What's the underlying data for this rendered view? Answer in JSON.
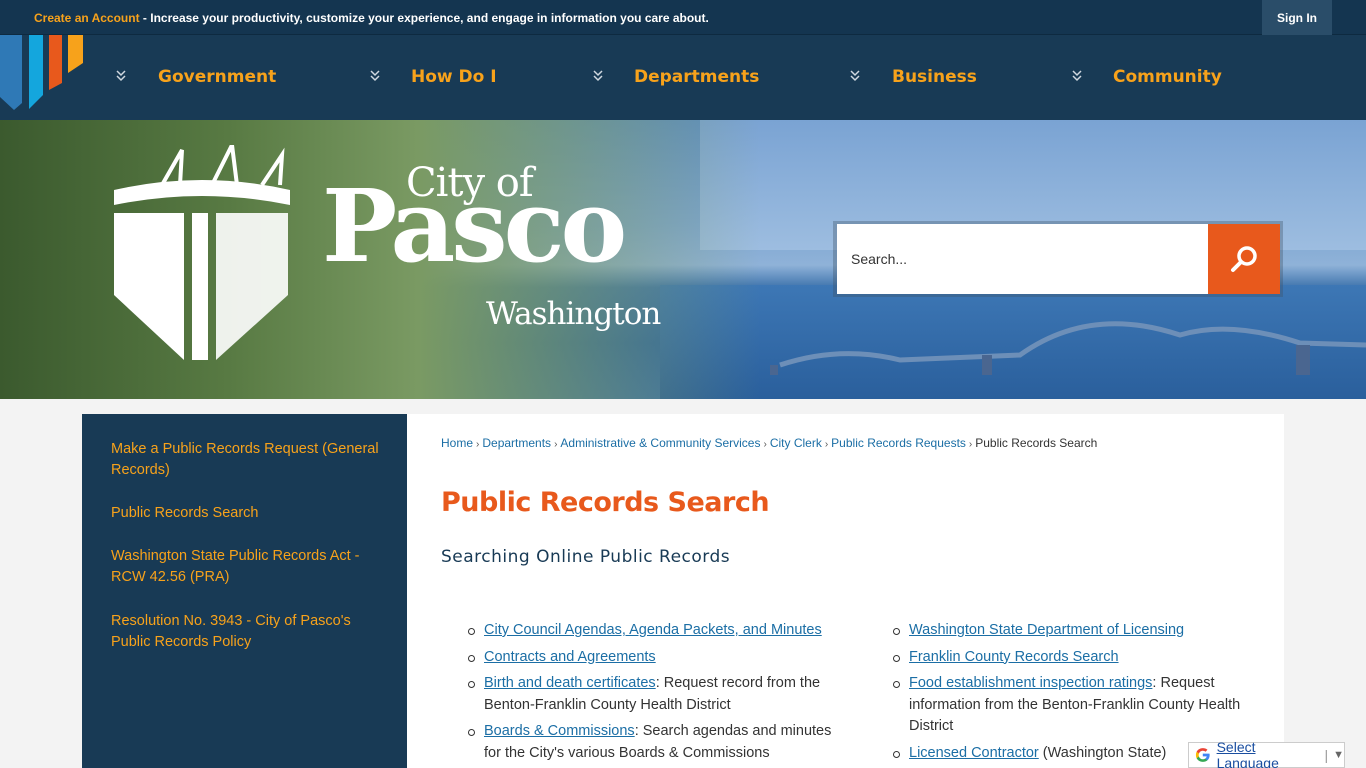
{
  "topbar": {
    "create_account": "Create an Account",
    "message": " - Increase your productivity, customize your experience, and engage in information you care about.",
    "sign_in": "Sign In"
  },
  "nav": {
    "items": [
      {
        "label": "Government"
      },
      {
        "label": "How Do I"
      },
      {
        "label": "Departments"
      },
      {
        "label": "Business"
      },
      {
        "label": "Community"
      }
    ]
  },
  "logo": {
    "city_of": "City of",
    "pasco": "Pasco",
    "washington": "Washington"
  },
  "search": {
    "placeholder": "Search..."
  },
  "sidebar": {
    "links": [
      {
        "label": "Make a Public Records Request (General Records)"
      },
      {
        "label": "Public Records Search"
      },
      {
        "label": "Washington State Public Records Act - RCW 42.56 (PRA)"
      },
      {
        "label": "Resolution No. 3943 - City of Pasco's Public Records Policy"
      }
    ]
  },
  "breadcrumb": {
    "items": [
      "Home",
      "Departments",
      "Administrative & Community Services",
      "City Clerk",
      "Public Records Requests"
    ],
    "current": "Public Records Search",
    "separator": "›"
  },
  "main": {
    "title": "Public Records Search",
    "subtitle": "Searching Online Public Records",
    "left_list": [
      {
        "link": "City Council Agendas, Agenda Packets, and Minutes",
        "text": ""
      },
      {
        "link": "Contracts and Agreements",
        "text": ""
      },
      {
        "link": "Birth and death certificates",
        "text": ": Request record from the Benton-Franklin County Health District"
      },
      {
        "link": "Boards & Commissions",
        "text": ": Search agendas and minutes for the City's various Boards & Commissions"
      }
    ],
    "right_list": [
      {
        "link": "Washington State Department of Licensing",
        "text": ""
      },
      {
        "link": "Franklin County Records Search",
        "text": ""
      },
      {
        "link": "Food establishment inspection ratings",
        "text": ": Request information from the Benton-Franklin County Health District"
      },
      {
        "link": "Licensed Contractor",
        "text": " (Washington State)"
      }
    ]
  },
  "translate": {
    "label": "Select Language",
    "separator": "|",
    "arrow": "▼"
  },
  "colors": {
    "navy": "#183a55",
    "orange": "#f7a21b",
    "accent": "#e8591c",
    "link": "#1b6ea5"
  }
}
